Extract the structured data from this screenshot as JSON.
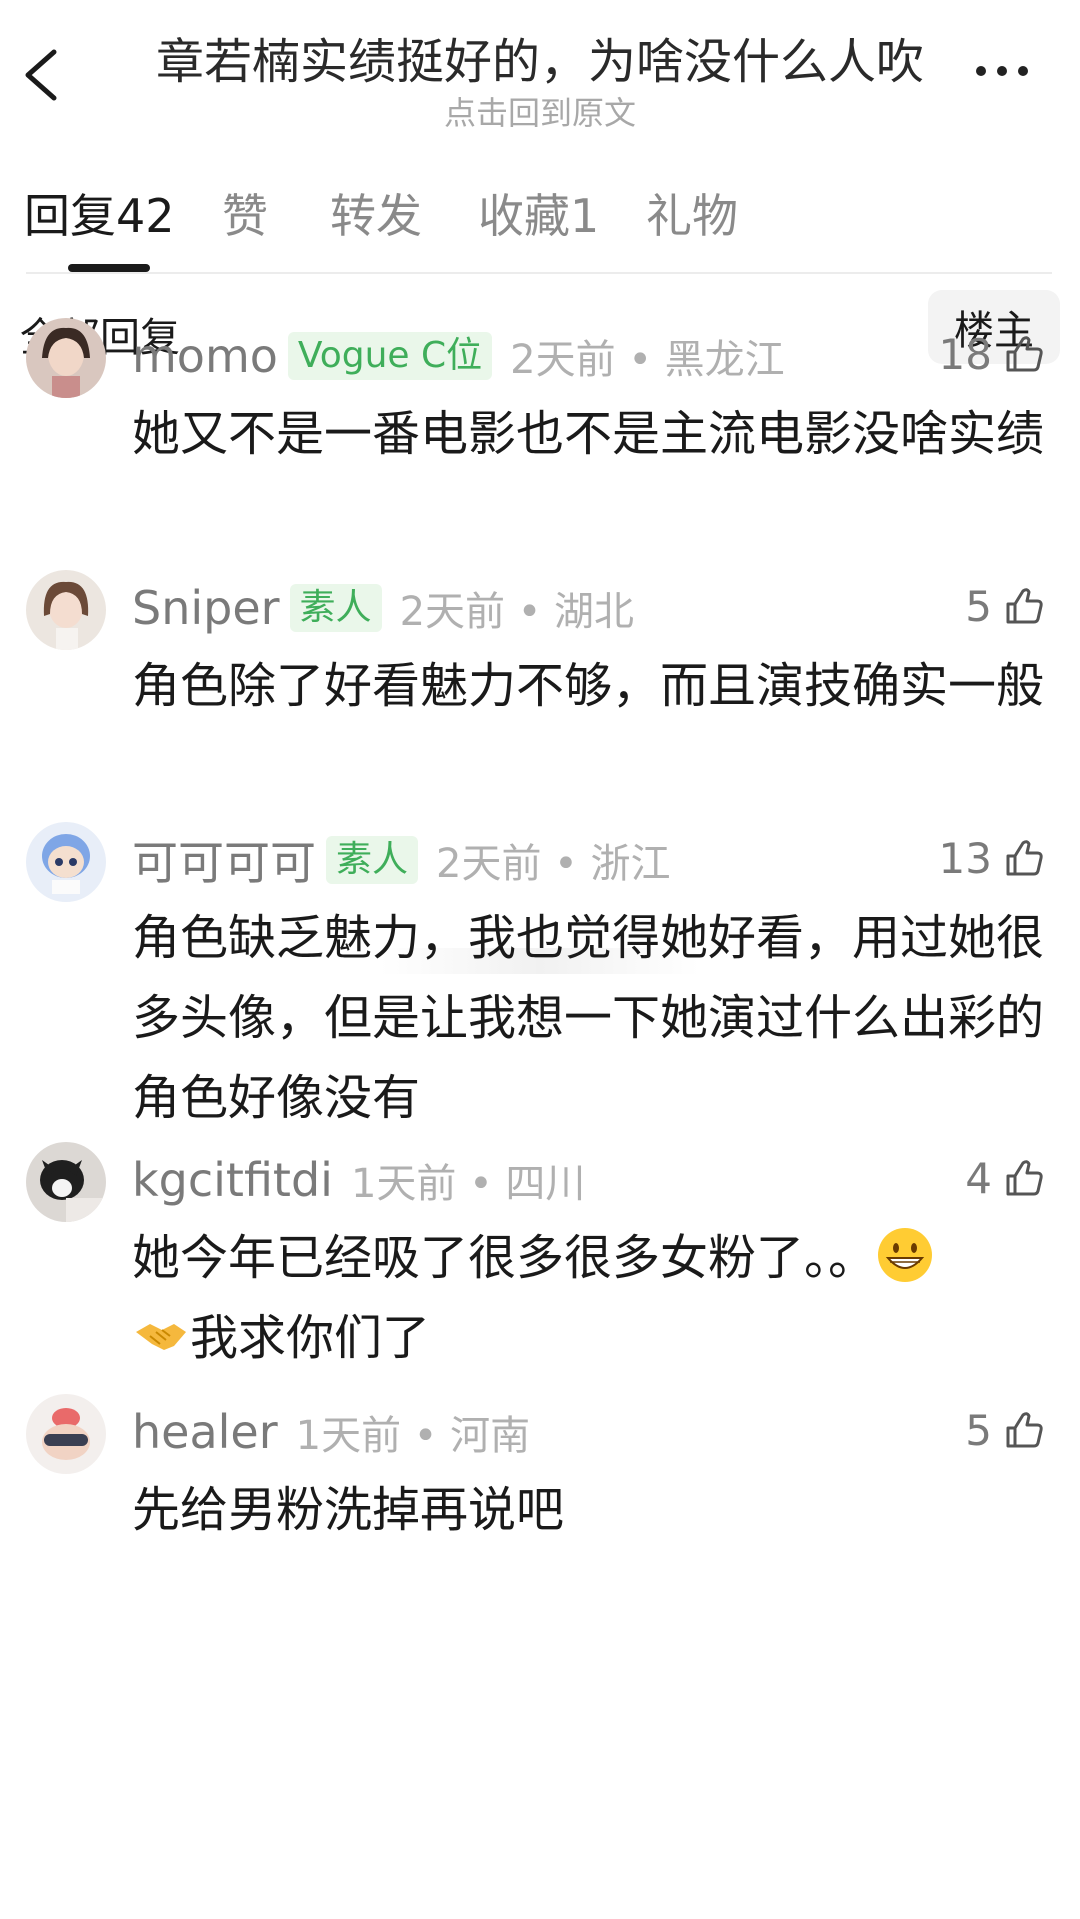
{
  "header": {
    "title": "章若楠实绩挺好的，为啥没什么人吹",
    "subtitle": "点击回到原文"
  },
  "tabs": [
    {
      "label": "回复42"
    },
    {
      "label": "赞"
    },
    {
      "label": "转发"
    },
    {
      "label": "收藏1"
    },
    {
      "label": "礼物"
    }
  ],
  "section": {
    "title": "全部回复",
    "filter_button": "楼主"
  },
  "comments": [
    {
      "user": "momo",
      "badge": "Vogue C位",
      "time_location": "2天前 • 黑龙江",
      "likes": "18",
      "text": "她又不是一番电影也不是主流电影没啥实绩"
    },
    {
      "user": "Sniper",
      "badge": "素人",
      "time_location": "2天前 • 湖北",
      "likes": "5",
      "text": "角色除了好看魅力不够，而且演技确实一般"
    },
    {
      "user": "可可可可",
      "badge": "素人",
      "time_location": "2天前 • 浙江",
      "likes": "13",
      "text": "角色缺乏魅力，我也觉得她好看，用过她很多头像，但是让我想一下她演过什么出彩的角色好像没有"
    },
    {
      "user": "kgcitfitdi",
      "time_location": "1天前 • 四川",
      "likes": "4",
      "text_part1": "她今年已经吸了很多很多女粉了。。",
      "text_part2": "我求你们了",
      "emojis": [
        "grinning-face-icon",
        "handshake-icon"
      ]
    },
    {
      "user": "healer",
      "time_location": "1天前 • 河南",
      "likes": "5",
      "text": "先给男粉洗掉再说吧"
    }
  ],
  "colors": {
    "badge_green": "#3fae5a",
    "badge_bg": "#eaf7ea",
    "muted_text": "#7a7a7a",
    "light_text": "#b0b0b0"
  }
}
